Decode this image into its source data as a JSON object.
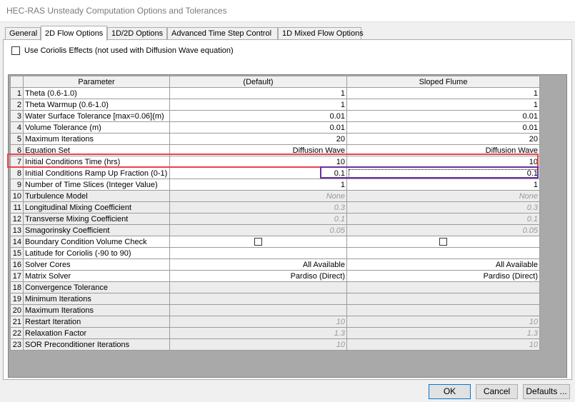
{
  "window": {
    "title": "HEC-RAS Unsteady Computation Options and Tolerances"
  },
  "tabs": [
    {
      "label": "General"
    },
    {
      "label": "2D Flow Options",
      "active": true
    },
    {
      "label": "1D/2D Options"
    },
    {
      "label": "Advanced Time Step Control"
    },
    {
      "label": "1D Mixed Flow Options"
    }
  ],
  "coriolis": {
    "label": "Use Coriolis Effects (not used with Diffusion Wave equation)",
    "checked": false
  },
  "grid": {
    "headers": [
      "Parameter",
      "(Default)",
      "Sloped Flume"
    ],
    "rows": [
      {
        "num": "1",
        "param": "Theta  (0.6-1.0)",
        "default": "1",
        "sloped": "1"
      },
      {
        "num": "2",
        "param": "Theta Warmup  (0.6-1.0)",
        "default": "1",
        "sloped": "1"
      },
      {
        "num": "3",
        "param": "Water Surface Tolerance [max=0.06](m)",
        "default": "0.01",
        "sloped": "0.01"
      },
      {
        "num": "4",
        "param": "Volume Tolerance (m)",
        "default": "0.01",
        "sloped": "0.01"
      },
      {
        "num": "5",
        "param": "Maximum Iterations",
        "default": "20",
        "sloped": "20"
      },
      {
        "num": "6",
        "param": "Equation Set",
        "default": "Diffusion Wave",
        "sloped": "Diffusion Wave"
      },
      {
        "num": "7",
        "param": "Initial Conditions Time (hrs)",
        "default": "10",
        "sloped": "10"
      },
      {
        "num": "8",
        "param": "Initial Conditions Ramp Up Fraction (0-1)",
        "default": "0.1",
        "sloped": "0.1"
      },
      {
        "num": "9",
        "param": "Number of Time Slices (Integer Value)",
        "default": "1",
        "sloped": "1"
      },
      {
        "num": "10",
        "param": "Turbulence Model",
        "default": "None",
        "sloped": "None"
      },
      {
        "num": "11",
        "param": "Longitudinal Mixing Coefficient",
        "default": "0.3",
        "sloped": "0.3"
      },
      {
        "num": "12",
        "param": "Transverse Mixing Coefficient",
        "default": "0.1",
        "sloped": "0.1"
      },
      {
        "num": "13",
        "param": "Smagorinsky Coefficient",
        "default": "0.05",
        "sloped": "0.05"
      },
      {
        "num": "14",
        "param": "Boundary Condition Volume Check",
        "default": "",
        "sloped": ""
      },
      {
        "num": "15",
        "param": "Latitude for Coriolis (-90 to 90)",
        "default": "",
        "sloped": ""
      },
      {
        "num": "16",
        "param": "Solver Cores",
        "default": "All Available",
        "sloped": "All Available"
      },
      {
        "num": "17",
        "param": "Matrix Solver",
        "default": "Pardiso (Direct)",
        "sloped": "Pardiso (Direct)"
      },
      {
        "num": "18",
        "param": "Convergence Tolerance",
        "default": "",
        "sloped": ""
      },
      {
        "num": "19",
        "param": "Minimum Iterations",
        "default": "",
        "sloped": ""
      },
      {
        "num": "20",
        "param": "Maximum Iterations",
        "default": "",
        "sloped": ""
      },
      {
        "num": "21",
        "param": "Restart Iteration",
        "default": "10",
        "sloped": "10"
      },
      {
        "num": "22",
        "param": "Relaxation Factor",
        "default": "1.3",
        "sloped": "1.3"
      },
      {
        "num": "23",
        "param": "SOR Preconditioner Iterations",
        "default": "10",
        "sloped": "10"
      }
    ]
  },
  "buttons": {
    "ok": "OK",
    "cancel": "Cancel",
    "defaults": "Defaults ..."
  },
  "colors": {
    "highlight_row": "#e8434d",
    "highlight_cell": "#6b2fa0",
    "disabled_text": "#9a9a9a",
    "grid_background": "#a9a9a9"
  }
}
